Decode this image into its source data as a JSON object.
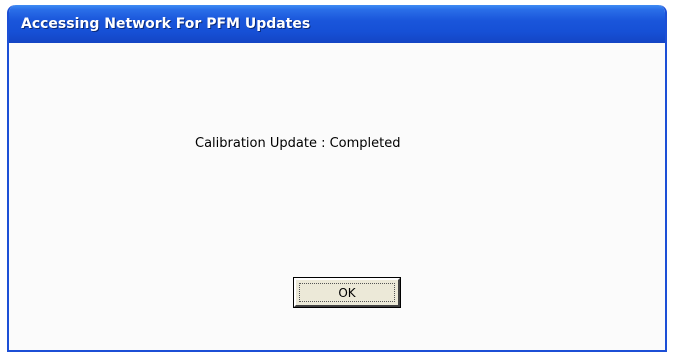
{
  "window": {
    "title": "Accessing Network For PFM Updates"
  },
  "dialog": {
    "message": "Calibration Update : Completed",
    "ok_label": "OK"
  },
  "colors": {
    "titlebar_blue": "#1650d6",
    "frame_blue": "#1c4fd6",
    "button_face": "#ece9d8"
  }
}
